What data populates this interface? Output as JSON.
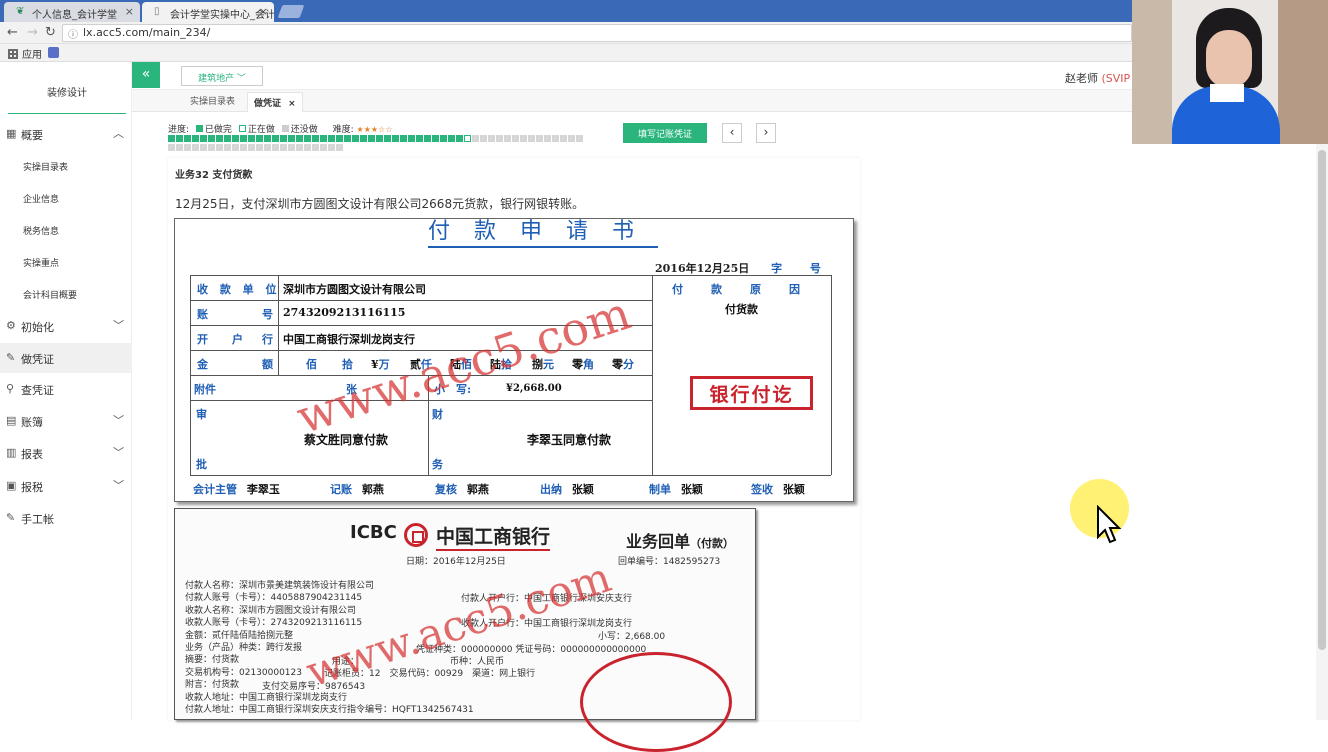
{
  "browser": {
    "tabs": [
      {
        "label": "个人信息_会计学堂",
        "close": "×"
      },
      {
        "label": "会计学堂实操中心_会计实...",
        "close": "×"
      }
    ],
    "url": "lx.acc5.com/main_234/",
    "bookmark_apps": "应用"
  },
  "sidebar": {
    "brand": "装修设计",
    "items": [
      {
        "label": "概要",
        "icon": "grid-icon",
        "chev": "︿"
      },
      {
        "label": "初始化",
        "icon": "gear-icon",
        "chev": "﹀"
      },
      {
        "label": "做凭证",
        "icon": "pen-icon",
        "chev": ""
      },
      {
        "label": "查凭证",
        "icon": "search-icon",
        "chev": ""
      },
      {
        "label": "账簿",
        "icon": "book-icon",
        "chev": "﹀"
      },
      {
        "label": "报表",
        "icon": "report-icon",
        "chev": "﹀"
      },
      {
        "label": "报税",
        "icon": "tax-icon",
        "chev": "﹀"
      },
      {
        "label": "手工帐",
        "icon": "pen-icon",
        "chev": ""
      }
    ],
    "subitems": [
      "实操目录表",
      "企业信息",
      "税务信息",
      "实操重点",
      "会计科目概要"
    ]
  },
  "header": {
    "collapse": "«",
    "industry": "建筑地产 ﹀",
    "teacher": "赵老师",
    "svip": "(SVIP"
  },
  "tabs": {
    "catalog": "实操目录表",
    "voucher": "做凭证",
    "close": "×"
  },
  "progress": {
    "label": "进度:",
    "done": "已做完",
    "doing": "正在做",
    "todo": "还没做",
    "difficulty": "难度:",
    "stars": "★★★☆☆",
    "done_count": 37,
    "current_index": 37,
    "total": 74,
    "colors": {
      "done": "#2ab57d",
      "doing": "#ffffff",
      "todo": "#d6d6d6"
    }
  },
  "actions": {
    "fill_voucher": "填写记账凭证",
    "prev": "‹",
    "next": "›"
  },
  "business": {
    "title": "业务32 支付货款",
    "desc": "12月25日，支付深圳市方圆图文设计有限公司2668元货款，银行网银转账。"
  },
  "form": {
    "title": "付款申请书",
    "date": "2016年12月25日",
    "zi": "字",
    "hao": "号",
    "payee_label": "收 款 单 位",
    "payee": "深圳市方圆图文设计有限公司",
    "account_label_a": "账",
    "account_label_b": "号",
    "account": "2743209213116115",
    "bank_label_a": "开",
    "bank_label_b": "户",
    "bank_label_c": "行",
    "bank": "中国工商银行深圳龙岗支行",
    "amount_label_a": "金",
    "amount_label_b": "额",
    "amount_units": [
      "佰",
      "拾",
      "¥万",
      "贰仟",
      "陆佰",
      "陆拾",
      "捌元",
      "零角",
      "零分"
    ],
    "attach_label": "附件",
    "attach_unit": "张",
    "small_label": "小　写:",
    "small_amount": "¥2,668.00",
    "reason_label": "付　　款　　原　　因",
    "reason": "付货款",
    "approve_a": "审",
    "approve_b": "批",
    "approve_text": "蔡文胜同意付款",
    "finance_a": "财",
    "finance_b": "务",
    "finance_text": "李翠玉同意付款",
    "stamp": "银行付讫",
    "footer": [
      {
        "label": "会计主管",
        "name": "李翠玉"
      },
      {
        "label": "记账",
        "name": "郭燕"
      },
      {
        "label": "复核",
        "name": "郭燕"
      },
      {
        "label": "出纳",
        "name": "张颖"
      },
      {
        "label": "制单",
        "name": "张颖"
      },
      {
        "label": "签收",
        "name": "张颖"
      }
    ],
    "watermark": "www.acc5.com"
  },
  "receipt": {
    "icbc": "ICBC",
    "bank_name": "中国工商银行",
    "title": "业务回单",
    "title_small": "（付款）",
    "date": "日期：2016年12月25日",
    "serial": "回单编号：1482595273",
    "lines": [
      "付款人名称：深圳市景美建筑装饰设计有限公司",
      "付款人账号（卡号）：4405887904231145",
      "收款人名称：深圳市方圆图文设计有限公司",
      "收款人账号（卡号）：2743209213116115",
      "金额：贰仟陆佰陆拾捌元整",
      "业务（产品）种类：跨行发报",
      "摘要：付货款",
      "交易机构号：02130000123",
      "附言：付货款",
      "收款人地址：中国工商银行深圳龙岗支行",
      "付款人地址：中国工商银行深圳安庆支行指令编号：HQFT1342567431"
    ],
    "right_lines": [
      "付款人开户行：中国工商银行深圳安庆支行",
      "收款人开户行：中国工商银行深圳龙岗支行",
      "小写：2,668.00",
      "凭证种类：000000000 凭证号码：000000000000000",
      "币种：人民币",
      "记账柜员：12　交易代码：00929　渠道：网上银行",
      "支付交易序号：9876543",
      "用途："
    ],
    "watermark": "www.acc5.com"
  }
}
